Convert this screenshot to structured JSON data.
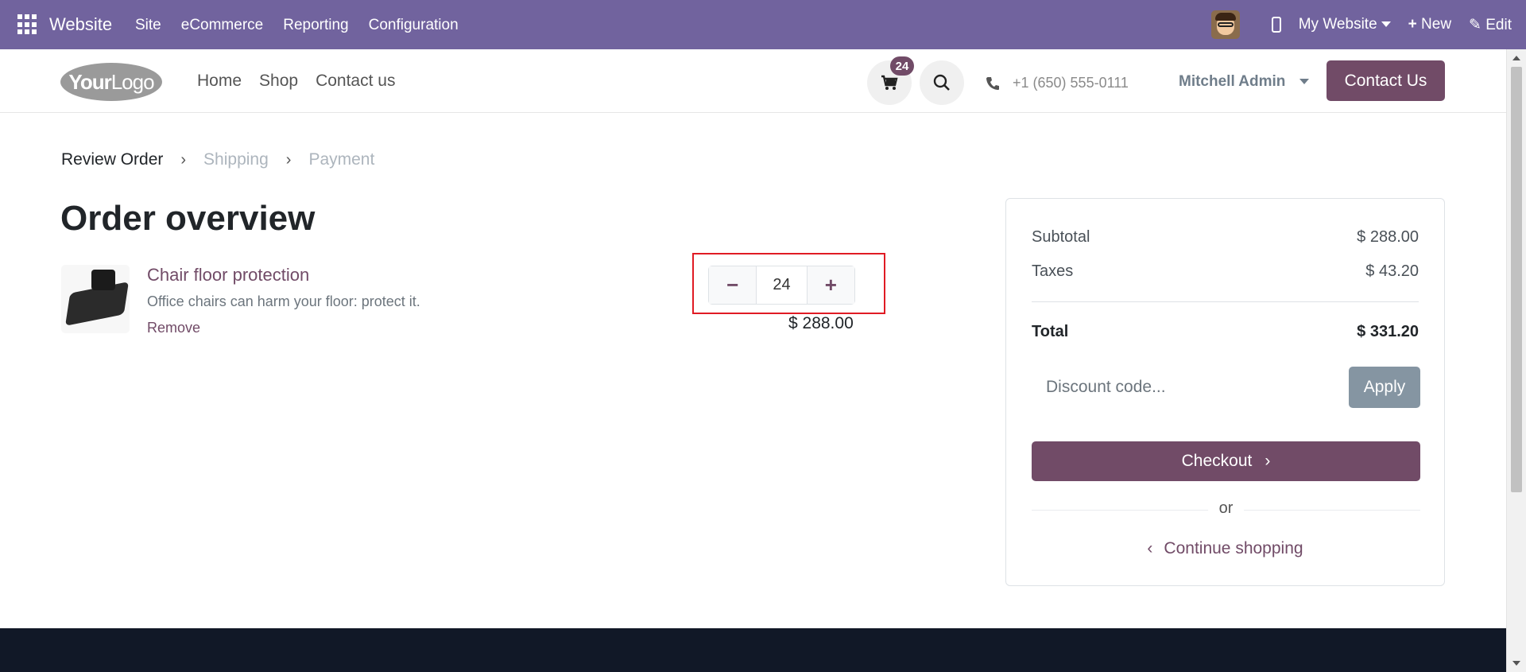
{
  "admin_bar": {
    "app_name": "Website",
    "menu": [
      "Site",
      "eCommerce",
      "Reporting",
      "Configuration"
    ],
    "website_switcher": "My Website",
    "new_label": "New",
    "edit_label": "Edit"
  },
  "header": {
    "logo_text_bold": "Your",
    "logo_text_light": "Logo",
    "nav": [
      "Home",
      "Shop",
      "Contact us"
    ],
    "cart_count": "24",
    "phone": "+1 (650) 555-0111",
    "user_name": "Mitchell Admin",
    "contact_button": "Contact Us"
  },
  "steps": {
    "review": "Review Order",
    "shipping": "Shipping",
    "payment": "Payment"
  },
  "page_title": "Order overview",
  "order_line": {
    "name": "Chair floor protection",
    "description": "Office chairs can harm your floor: protect it.",
    "remove_label": "Remove",
    "quantity": "24",
    "price": "$ 288.00"
  },
  "summary": {
    "subtotal_label": "Subtotal",
    "subtotal_value": "$ 288.00",
    "taxes_label": "Taxes",
    "taxes_value": "$ 43.20",
    "total_label": "Total",
    "total_value": "$ 331.20",
    "discount_placeholder": "Discount code...",
    "apply_label": "Apply",
    "checkout_label": "Checkout",
    "or_label": "or",
    "continue_label": "Continue shopping"
  },
  "colors": {
    "admin_bar": "#71639e",
    "brand": "#714b67",
    "apply_button": "#8595a2",
    "highlight_box": "#e01b24",
    "footer": "#111827"
  }
}
